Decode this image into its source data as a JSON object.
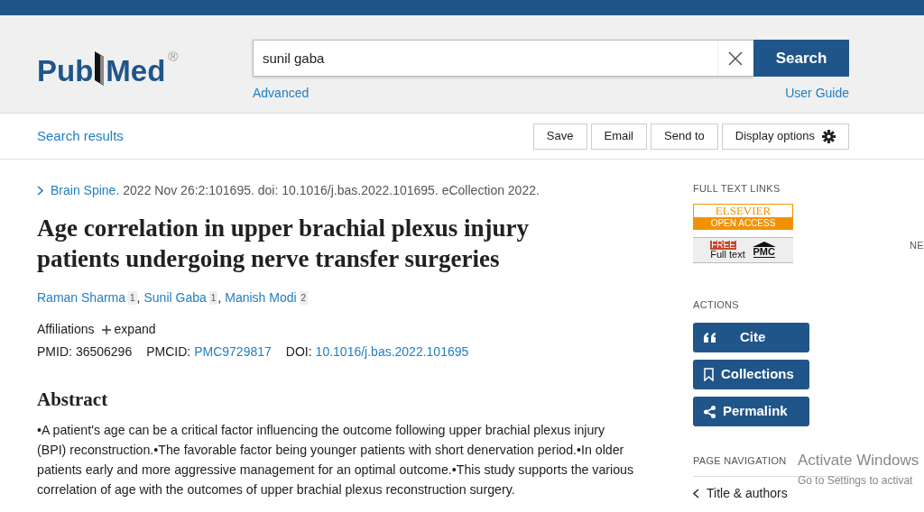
{
  "header": {
    "logo": {
      "left": "Pub",
      "right": "Med",
      "mark": "®"
    },
    "search": {
      "value": "sunil gaba",
      "button": "Search",
      "advanced": "Advanced",
      "user_guide": "User Guide"
    }
  },
  "toolbar": {
    "back_link": "Search results",
    "buttons": [
      {
        "label": "Save",
        "kind": "plain"
      },
      {
        "label": "Email",
        "kind": "plain"
      },
      {
        "label": "Send to",
        "kind": "plain"
      },
      {
        "label": "Display options",
        "kind": "settings"
      }
    ]
  },
  "article": {
    "journal": "Brain Spine.",
    "citation": "2022 Nov 26:2:101695. doi: 10.1016/j.bas.2022.101695. eCollection 2022.",
    "title": "Age correlation in upper brachial plexus injury patients undergoing nerve transfer surgeries",
    "authors": [
      {
        "name": "Raman Sharma",
        "affiliation": "1"
      },
      {
        "name": "Sunil Gaba",
        "affiliation": "1"
      },
      {
        "name": "Manish Modi",
        "affiliation": "2"
      }
    ],
    "author_separator": ",",
    "affiliations_label": "Affiliations",
    "expand": "expand",
    "ids": [
      {
        "label": "PMID:",
        "value": "36506296",
        "link": false
      },
      {
        "label": "PMCID:",
        "value": "PMC9729817",
        "link": true
      },
      {
        "label": "DOI:",
        "value": "10.1016/j.bas.2022.101695",
        "link": true
      }
    ],
    "abstract_heading": "Abstract",
    "abstract": "•A patient's age can be a critical factor influencing the outcome following upper brachial plexus injury (BPI) reconstruction.•The favorable factor being younger patients with short denervation period.•In older patients early and more aggressive management for an optimal outcome.•This study supports the various correlation of age with the outcomes of upper brachial plexus reconstruction surgery."
  },
  "sidebar": {
    "full_text_heading": "FULL TEXT LINKS",
    "elsevier": {
      "name": "ELSEVIER",
      "access": "OPEN ACCESS"
    },
    "pmc": {
      "free": "FREE",
      "full_text": "Full text",
      "name": "PMC"
    },
    "actions_heading": "ACTIONS",
    "actions": [
      {
        "label": "Cite",
        "kind": "quote"
      },
      {
        "label": "Collections",
        "kind": "bookmark"
      },
      {
        "label": "Permalink",
        "kind": "share"
      }
    ],
    "page_nav_heading": "PAGE NAVIGATION",
    "page_nav": [
      "Title & authors"
    ]
  },
  "far_right_label": "NE",
  "os_notice": {
    "title": "Activate Windows",
    "text": "Go to Settings to activat"
  }
}
